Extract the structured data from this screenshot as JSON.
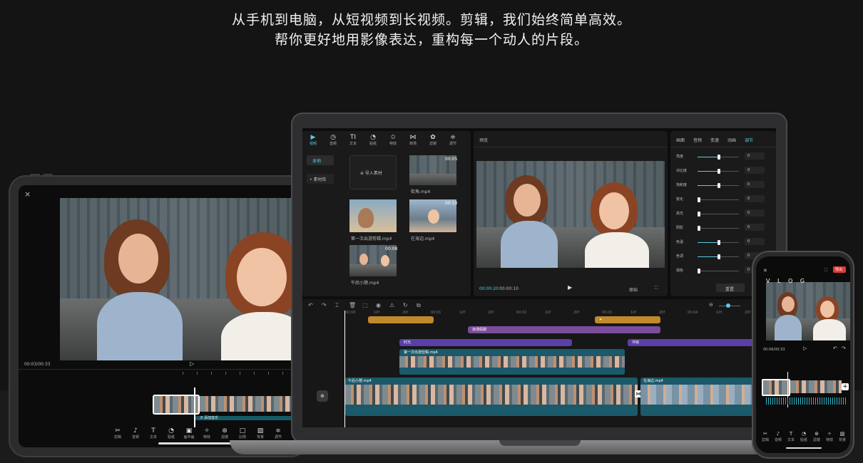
{
  "hero": {
    "line1": "从手机到电脑，从短视频到长视频。剪辑，我们始终简单高效。",
    "line2": "帮你更好地用影像表达，重构每一个动人的片段。"
  },
  "tablet": {
    "close": "×",
    "time": "00:03/00:33",
    "play": "▷",
    "music_label": "♬ 添加音乐",
    "tools": [
      {
        "icon": "✂",
        "label": "剪辑"
      },
      {
        "icon": "♪",
        "label": "音频"
      },
      {
        "icon": "T",
        "label": "文本"
      },
      {
        "icon": "◔",
        "label": "贴纸"
      },
      {
        "icon": "▣",
        "label": "画中画"
      },
      {
        "icon": "✧",
        "label": "特效"
      },
      {
        "icon": "⊛",
        "label": "滤镜"
      },
      {
        "icon": "□",
        "label": "比例"
      },
      {
        "icon": "▨",
        "label": "背景"
      },
      {
        "icon": "≑",
        "label": "调节"
      }
    ]
  },
  "laptop": {
    "tabs": [
      {
        "icon": "▶",
        "label": "视频"
      },
      {
        "icon": "◷",
        "label": "音频"
      },
      {
        "icon": "TI",
        "label": "文本"
      },
      {
        "icon": "◔",
        "label": "贴纸"
      },
      {
        "icon": "✩",
        "label": "特效"
      },
      {
        "icon": "⋈",
        "label": "转场"
      },
      {
        "icon": "✿",
        "label": "滤镜"
      },
      {
        "icon": "≑",
        "label": "调节"
      }
    ],
    "media_nav": [
      "本地",
      "• 素材库"
    ],
    "import_label": "⊕ 导入素材",
    "media": [
      {
        "name": "街角.mp4",
        "dur": "00:05"
      },
      {
        "name": "第一次出游剪辑.mp4",
        "dur": ""
      },
      {
        "name": "在海边.mp4",
        "dur": "00:10"
      },
      {
        "name": "午后小憩.mp4",
        "dur": "00:08"
      }
    ],
    "preview_title": "预览",
    "time_cur": "00:00:20",
    "time_total": "00:00:10",
    "ratio_btn": "原始",
    "adjust_tabs": [
      "画面",
      "音频",
      "变速",
      "动画",
      "调节"
    ],
    "adjust_rows": [
      {
        "name": "亮度",
        "val": "0",
        "pos": 0.5
      },
      {
        "name": "对比度",
        "val": "0",
        "pos": 0.5
      },
      {
        "name": "饱和度",
        "val": "0",
        "pos": 0.5
      },
      {
        "name": "锐化",
        "val": "0",
        "pos": 0.0
      },
      {
        "name": "高光",
        "val": "0",
        "pos": 0.0
      },
      {
        "name": "阴影",
        "val": "0",
        "pos": 0.0
      },
      {
        "name": "色温",
        "val": "0",
        "pos": 0.5
      },
      {
        "name": "色调",
        "val": "0",
        "pos": 0.5
      },
      {
        "name": "褪色",
        "val": "0",
        "pos": 0.0
      }
    ],
    "reset": "重置",
    "ruler": [
      "00:00",
      "10f",
      "20f",
      "00:01",
      "10f",
      "20f",
      "00:02",
      "10f",
      "20f",
      "00:03",
      "10f",
      "20f",
      "00:04",
      "10f",
      "20f",
      "00:05"
    ],
    "clips": {
      "text1": "浪漫假期",
      "sticker": "✦",
      "fx1": "时光",
      "fx2": "冲浪",
      "video_overlay": "第一次出游剪辑.mp4",
      "main1": "午后小憩.mp4",
      "main2": "在海边.mp4"
    }
  },
  "phone": {
    "close": "✕",
    "export": "导出",
    "title": "V L O G",
    "time": "00:06/00:33",
    "play": "▷",
    "tools": [
      {
        "icon": "✂",
        "label": "剪辑"
      },
      {
        "icon": "♪",
        "label": "音频"
      },
      {
        "icon": "T",
        "label": "文本"
      },
      {
        "icon": "◔",
        "label": "贴纸"
      },
      {
        "icon": "⊛",
        "label": "滤镜"
      },
      {
        "icon": "✧",
        "label": "特效"
      },
      {
        "icon": "▨",
        "label": "背景"
      }
    ]
  }
}
